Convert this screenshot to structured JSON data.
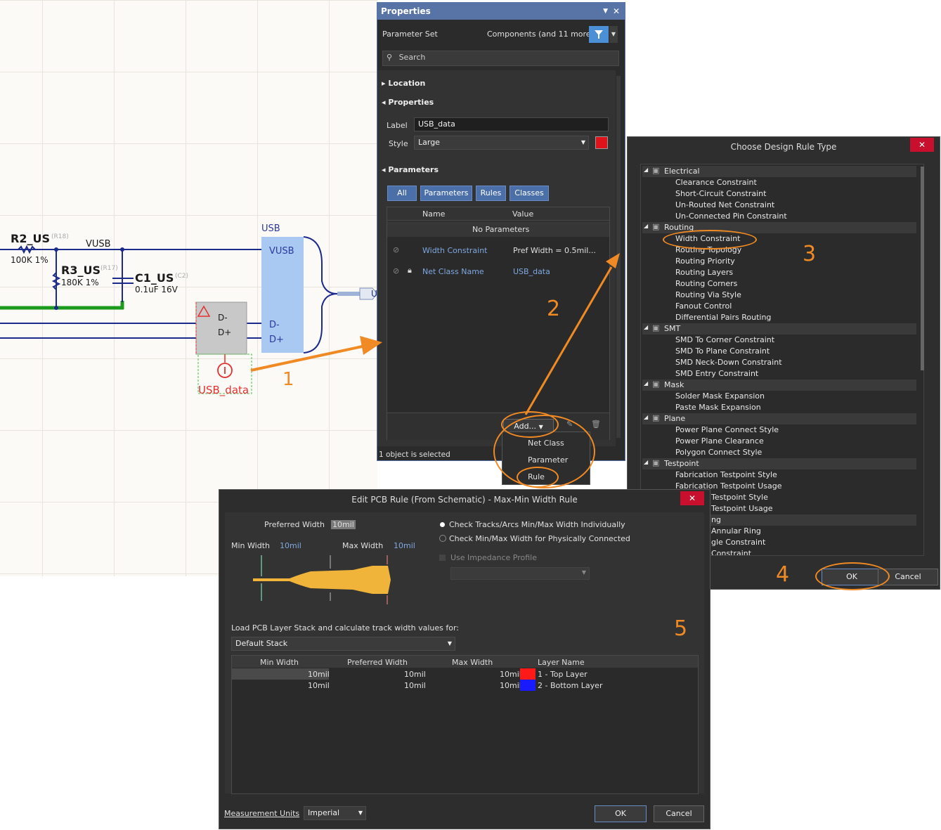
{
  "schematic": {
    "r2_name": "R2_US",
    "r2_des": "(R18)",
    "r2_val": "100K 1%",
    "r3_name": "R3_US",
    "r3_des": "(R17)",
    "r3_val": "180K 1%",
    "c1_name": "C1_US",
    "c1_des": "(C2)",
    "c1_val": "0.1uF 16V",
    "net_vusb": "VUSB",
    "harness_title": "USB",
    "harness_vusb": "VUSB",
    "harness_dm": "D-",
    "harness_dp": "D+",
    "comp_dm": "D-",
    "comp_dp": "D+",
    "directive_label": "USB_data",
    "harness_edge_char": "U"
  },
  "properties": {
    "title": "Properties",
    "parameter_set_label": "Parameter Set",
    "parameter_set_value": "Components (and 11 more)",
    "search_placeholder": "Search",
    "section_location": "Location",
    "section_properties": "Properties",
    "label_label": "Label",
    "label_value": "USB_data",
    "style_label": "Style",
    "style_value": "Large",
    "style_color": "#e0131b",
    "section_parameters": "Parameters",
    "tabs": [
      "All",
      "Parameters",
      "Rules",
      "Classes"
    ],
    "col_name": "Name",
    "col_value": "Value",
    "no_params": "No Parameters",
    "rows": [
      {
        "name": "Width Constraint",
        "value": "Pref Width = 0.5mil..."
      },
      {
        "name": "Net Class Name",
        "value": "USB_data"
      }
    ],
    "add_button": "Add...",
    "status": "1 object is selected",
    "add_menu": [
      "Net Class",
      "Parameter",
      "Rule"
    ]
  },
  "rule_type": {
    "title": "Choose Design Rule Type",
    "categories": [
      {
        "name": "Electrical",
        "items": [
          "Clearance Constraint",
          "Short-Circuit Constraint",
          "Un-Routed Net Constraint",
          "Un-Connected Pin Constraint"
        ]
      },
      {
        "name": "Routing",
        "items": [
          "Width Constraint",
          "Routing Topology",
          "Routing Priority",
          "Routing Layers",
          "Routing Corners",
          "Routing Via Style",
          "Fanout Control",
          "Differential Pairs Routing"
        ]
      },
      {
        "name": "SMT",
        "items": [
          "SMD To Corner Constraint",
          "SMD To Plane Constraint",
          "SMD Neck-Down Constraint",
          "SMD Entry Constraint"
        ]
      },
      {
        "name": "Mask",
        "items": [
          "Solder Mask Expansion",
          "Paste Mask Expansion"
        ]
      },
      {
        "name": "Plane",
        "items": [
          "Power Plane Connect Style",
          "Power Plane Clearance",
          "Polygon Connect Style"
        ]
      },
      {
        "name": "Testpoint",
        "items": [
          "Fabrication Testpoint Style",
          "Fabrication Testpoint Usage",
          "Testpoint Style",
          "Testpoint Usage"
        ]
      }
    ],
    "partial_rows": [
      "ng",
      "Annular Ring",
      "gle Constraint",
      "Constraint"
    ],
    "ok": "OK",
    "cancel": "Cancel"
  },
  "edit_rule": {
    "title": "Edit PCB Rule (From Schematic) - Max-Min Width Rule",
    "preferred_width_label": "Preferred Width",
    "preferred_width_value": "10mil",
    "min_width_label": "Min Width",
    "min_width_value": "10mil",
    "max_width_label": "Max Width",
    "max_width_value": "10mil",
    "radio1": "Check Tracks/Arcs Min/Max Width Individually",
    "radio2": "Check Min/Max Width for Physically Connected",
    "impedance_label": "Use Impedance Profile",
    "layer_stack_label": "Load PCB Layer Stack and calculate track width values for:",
    "layer_stack_value": "Default Stack",
    "grid_headers": [
      "Min Width",
      "Preferred Width",
      "Max Width",
      "Layer Name"
    ],
    "grid_rows": [
      {
        "min": "10mil",
        "pref": "10mil",
        "max": "10mil",
        "color": "#ff1a1a",
        "layer": "1 - Top Layer"
      },
      {
        "min": "10mil",
        "pref": "10mil",
        "max": "10mil",
        "color": "#1a1aff",
        "layer": "2 - Bottom Layer"
      }
    ],
    "units_label": "Measurement Units",
    "units_value": "Imperial",
    "ok": "OK",
    "cancel": "Cancel"
  },
  "steps": [
    "1",
    "2",
    "3",
    "4",
    "5"
  ],
  "accent": "#f08a24"
}
